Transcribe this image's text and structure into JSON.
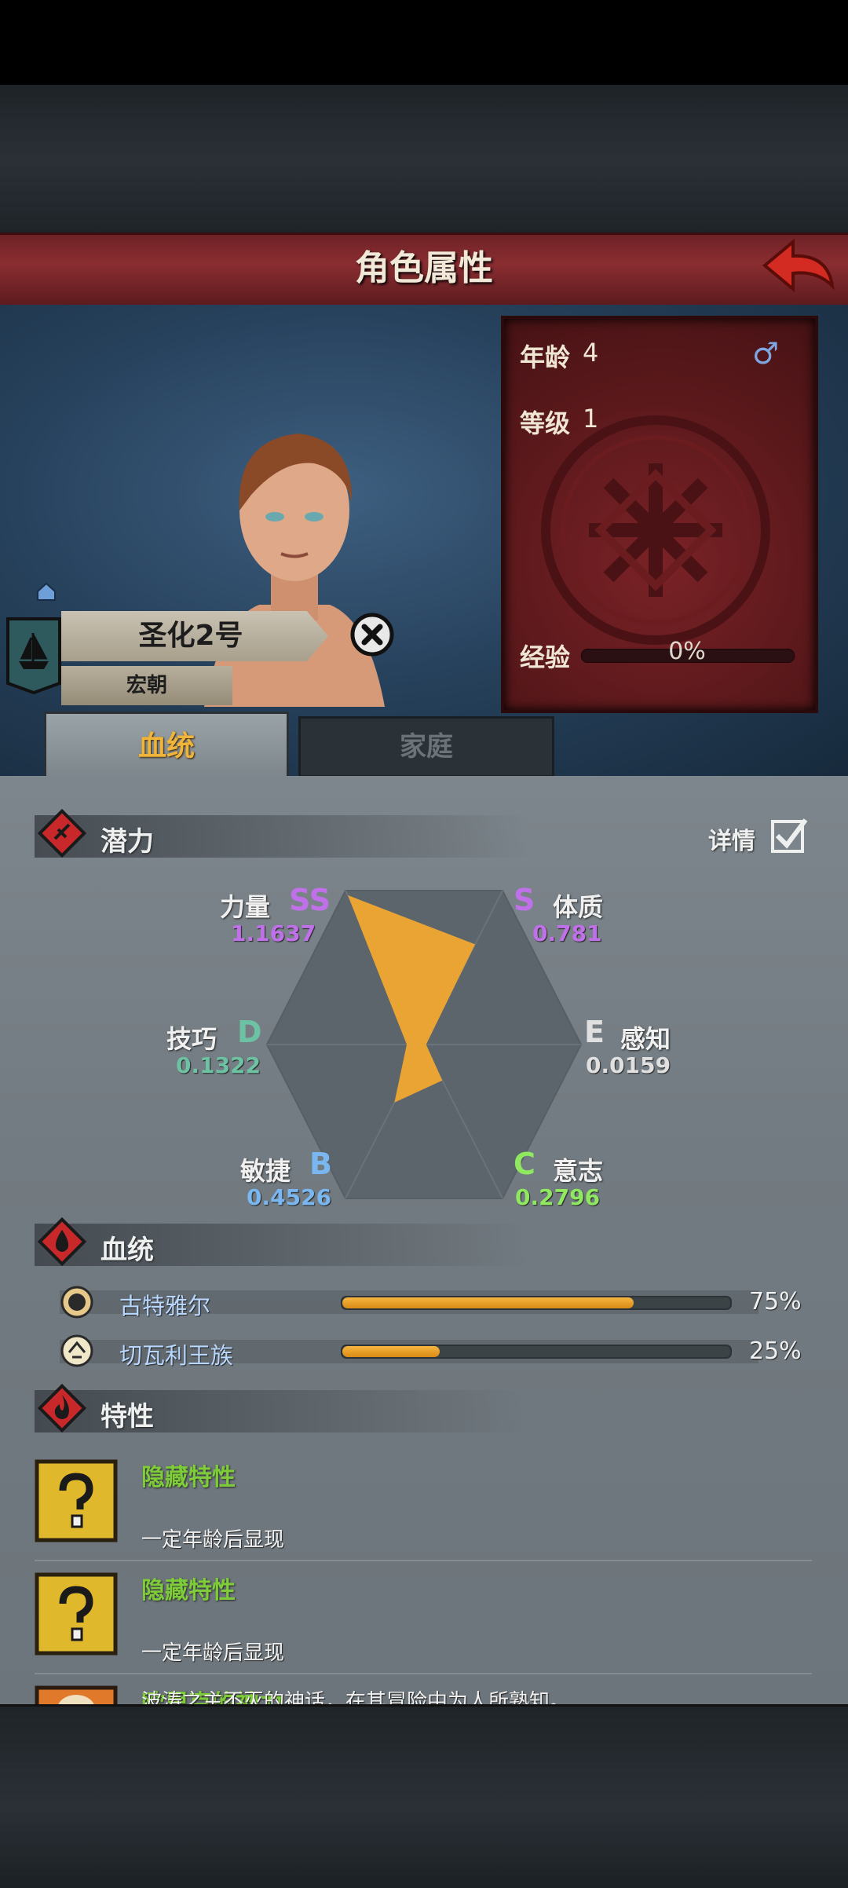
{
  "header": {
    "title": "角色属性"
  },
  "info": {
    "age_label": "年龄",
    "age": "4",
    "gender_symbol": "♂",
    "level_label": "等级",
    "level": "1",
    "exp_label": "经验",
    "exp": "0%",
    "exp_fraction": 0
  },
  "character": {
    "name": "圣化2号",
    "dynasty": "宏朝"
  },
  "tabs": [
    {
      "label": "血统",
      "active": true
    },
    {
      "label": "家庭",
      "active": false
    }
  ],
  "potential": {
    "title": "潜力",
    "details_label": "详情",
    "details_checked": true,
    "stats": [
      {
        "name": "力量",
        "grade": "SS",
        "value": "1.1637",
        "color": "#c070e8"
      },
      {
        "name": "体质",
        "grade": "S",
        "value": "0.781",
        "color": "#c070e8"
      },
      {
        "name": "感知",
        "grade": "E",
        "value": "0.0159",
        "color": "#e0e0e0"
      },
      {
        "name": "意志",
        "grade": "C",
        "value": "0.2796",
        "color": "#8fe860"
      },
      {
        "name": "敏捷",
        "grade": "B",
        "value": "0.4526",
        "color": "#7ab6f0"
      },
      {
        "name": "技巧",
        "grade": "D",
        "value": "0.1322",
        "color": "#6ec2a4"
      }
    ]
  },
  "bloodline": {
    "title": "血统",
    "items": [
      {
        "name": "古特雅尔",
        "percent": "75%",
        "fraction": 0.75
      },
      {
        "name": "切瓦利王族",
        "percent": "25%",
        "fraction": 0.25
      }
    ]
  },
  "traits": {
    "title": "特性",
    "items": [
      {
        "title": "隐藏特性",
        "desc": "一定年龄后显现",
        "icon": "question-mark-icon"
      },
      {
        "title": "隐藏特性",
        "desc": "一定年龄后显现",
        "icon": "question-mark-icon"
      },
      {
        "title": "欧里克的神力",
        "desc": "波涛之主不灭的神话，在其冒险中为人所熟知。",
        "icon": "sun-face-icon"
      }
    ]
  },
  "colors": {
    "accent_red": "#8a2d31",
    "potential_fill": "#f0a830",
    "trait_green": "#7ecc3a"
  }
}
